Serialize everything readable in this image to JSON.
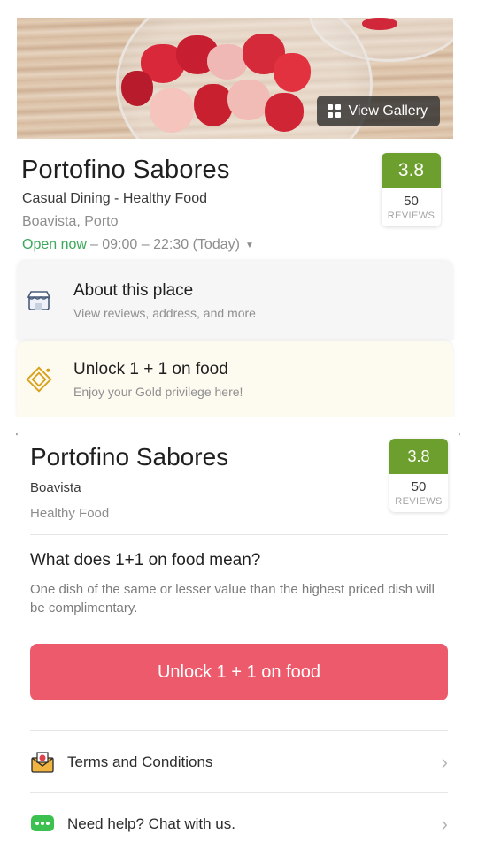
{
  "hero": {
    "gallery_label": "View Gallery"
  },
  "restaurant_card": {
    "name": "Portofino Sabores",
    "categories": "Casual Dining - Healthy Food",
    "location": "Boavista, Porto",
    "hours_open": "Open now",
    "hours_range": " – 09:00 – 22:30 (Today)",
    "rating": {
      "score": "3.8",
      "count": "50",
      "label": "REVIEWS"
    }
  },
  "rows": {
    "about": {
      "title": "About this place",
      "subtitle": "View reviews, address, and more"
    },
    "unlock": {
      "title": "Unlock 1 + 1 on food",
      "subtitle": "Enjoy your Gold privilege here!"
    }
  },
  "sheet": {
    "name": "Portofino Sabores",
    "area": "Boavista",
    "cuisine": "Healthy Food",
    "rating": {
      "score": "3.8",
      "count": "50",
      "label": "REVIEWS"
    },
    "question": "What does 1+1 on food mean?",
    "answer": "One dish of the same or lesser value than the highest priced dish will be complimentary.",
    "cta_label": "Unlock 1 + 1 on food",
    "links": [
      {
        "label": "Terms and Conditions"
      },
      {
        "label": "Need help? Chat with us."
      }
    ]
  },
  "colors": {
    "rating_green": "#6d9f2f",
    "open_green": "#3aa85a",
    "cta_red": "#ed5a6b"
  }
}
